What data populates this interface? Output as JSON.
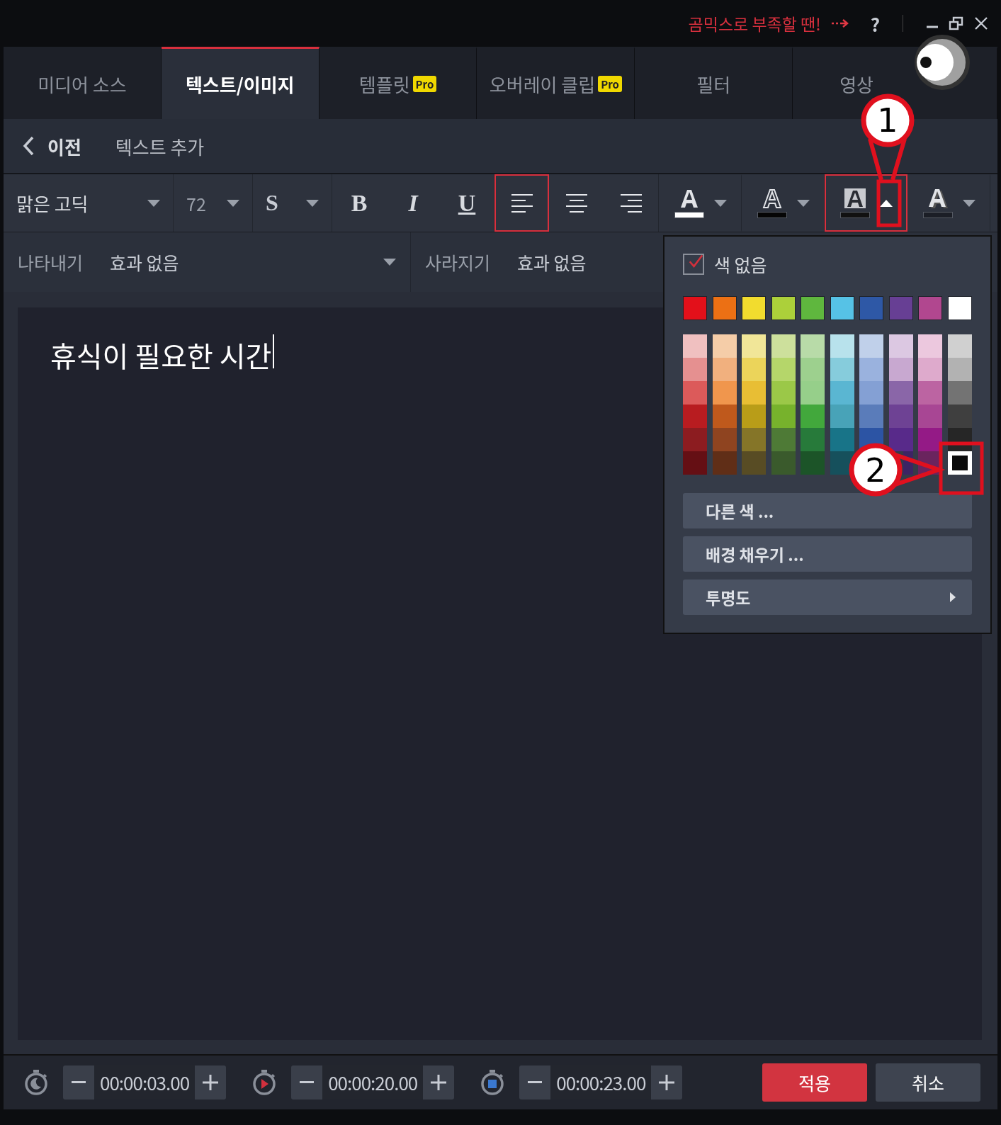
{
  "top_bar": {
    "promo_link": "곰믹스로 부족할 땐!",
    "help": "?"
  },
  "tabs": [
    {
      "label": "미디어 소스",
      "selected": false
    },
    {
      "label": "텍스트/이미지",
      "selected": true
    },
    {
      "label": "템플릿",
      "selected": false,
      "badge": "Pro"
    },
    {
      "label": "오버레이 클립",
      "selected": false,
      "badge": "Pro"
    },
    {
      "label": "필터",
      "selected": false
    },
    {
      "label": "영상",
      "selected": false
    }
  ],
  "nav": {
    "back": "이전",
    "title": "텍스트 추가"
  },
  "toolbar": {
    "font": "맑은 고딕",
    "size": "72",
    "style": "S",
    "format_buttons": [
      {
        "kind": "bold",
        "label": "B"
      },
      {
        "kind": "italic",
        "label": "I"
      },
      {
        "kind": "underline",
        "label": "U"
      }
    ],
    "align_buttons": [
      {
        "kind": "left",
        "selected": true
      },
      {
        "kind": "center",
        "selected": false
      },
      {
        "kind": "right",
        "selected": false
      }
    ],
    "color_buttons": [
      {
        "kind": "text",
        "color": "#ffffff",
        "open": false
      },
      {
        "kind": "outline",
        "color": "#050505",
        "open": false
      },
      {
        "kind": "background",
        "color": "#111111",
        "open": true
      },
      {
        "kind": "shadow",
        "color": "#1b1e26",
        "open": false
      }
    ]
  },
  "effects": [
    {
      "label": "나타내기",
      "value": "효과 없음",
      "dropdown": true
    },
    {
      "label": "사라지기",
      "value": "효과 없음",
      "dropdown": false
    }
  ],
  "editor": {
    "text": "휴식이 필요한 시간"
  },
  "color_popup": {
    "no_color": {
      "label": "색 없음",
      "checked": true
    },
    "base_colors": [
      {
        "color": "#e3101a",
        "selected": false
      },
      {
        "color": "#ec7014",
        "selected": false
      },
      {
        "color": "#f2dc2e",
        "selected": false
      },
      {
        "color": "#acd03a",
        "selected": false
      },
      {
        "color": "#5fb73e",
        "selected": false
      },
      {
        "color": "#56c2e6",
        "selected": false
      },
      {
        "color": "#2e58a6",
        "selected": false
      },
      {
        "color": "#673f94",
        "selected": false
      },
      {
        "color": "#b1478f",
        "selected": false
      },
      {
        "color": "#ffffff",
        "selected": false
      }
    ],
    "shade_columns": [
      [
        {
          "color": "#f0c0c0",
          "selected": false
        },
        {
          "color": "#e59090",
          "selected": false
        },
        {
          "color": "#dc5a5a",
          "selected": false
        },
        {
          "color": "#b81c20",
          "selected": false
        },
        {
          "color": "#8c1c20",
          "selected": false
        },
        {
          "color": "#650f14",
          "selected": false
        }
      ],
      [
        {
          "color": "#f5cda8",
          "selected": false
        },
        {
          "color": "#f1b07e",
          "selected": false
        },
        {
          "color": "#f0964d",
          "selected": false
        },
        {
          "color": "#bf591c",
          "selected": false
        },
        {
          "color": "#8f4420",
          "selected": false
        },
        {
          "color": "#602e17",
          "selected": false
        }
      ],
      [
        {
          "color": "#f1e698",
          "selected": false
        },
        {
          "color": "#ebd45a",
          "selected": false
        },
        {
          "color": "#e8be34",
          "selected": false
        },
        {
          "color": "#b99d18",
          "selected": false
        },
        {
          "color": "#857528",
          "selected": false
        },
        {
          "color": "#584c24",
          "selected": false
        }
      ],
      [
        {
          "color": "#cde09c",
          "selected": false
        },
        {
          "color": "#b5d66a",
          "selected": false
        },
        {
          "color": "#9bc848",
          "selected": false
        },
        {
          "color": "#77b22c",
          "selected": false
        },
        {
          "color": "#4e7a36",
          "selected": false
        },
        {
          "color": "#3a5a2c",
          "selected": false
        }
      ],
      [
        {
          "color": "#b8dba8",
          "selected": false
        },
        {
          "color": "#9dd08e",
          "selected": false
        },
        {
          "color": "#96cf8a",
          "selected": false
        },
        {
          "color": "#42a83c",
          "selected": false
        },
        {
          "color": "#277a3a",
          "selected": false
        },
        {
          "color": "#1c5428",
          "selected": false
        }
      ],
      [
        {
          "color": "#b8e2ec",
          "selected": false
        },
        {
          "color": "#86ccdc",
          "selected": false
        },
        {
          "color": "#5ab6d2",
          "selected": false
        },
        {
          "color": "#48a3b8",
          "selected": false
        },
        {
          "color": "#187488",
          "selected": false
        },
        {
          "color": "#16505c",
          "selected": false
        }
      ],
      [
        {
          "color": "#c0d0ea",
          "selected": false
        },
        {
          "color": "#9ab2de",
          "selected": false
        },
        {
          "color": "#84a0d4",
          "selected": false
        },
        {
          "color": "#5a7cba",
          "selected": false
        },
        {
          "color": "#2c54a4",
          "selected": false
        }
      ],
      [
        {
          "color": "#dcc8e2",
          "selected": false
        },
        {
          "color": "#c8a8d0",
          "selected": false
        },
        {
          "color": "#8a66a8",
          "selected": false
        },
        {
          "color": "#6e4294",
          "selected": false
        },
        {
          "color": "#582a8a",
          "selected": false
        },
        {
          "color": "#3c2464",
          "selected": false
        }
      ],
      [
        {
          "color": "#ecc8de",
          "selected": false
        },
        {
          "color": "#deaacc",
          "selected": false
        },
        {
          "color": "#bc64a2",
          "selected": false
        },
        {
          "color": "#a84694",
          "selected": false
        },
        {
          "color": "#941a86",
          "selected": false
        },
        {
          "color": "#6a245e",
          "selected": false
        }
      ],
      [
        {
          "color": "#d0d0d0",
          "selected": false
        },
        {
          "color": "#b2b2b2",
          "selected": false
        },
        {
          "color": "#737373",
          "selected": false
        },
        {
          "color": "#3f3f3f",
          "selected": false
        },
        {
          "color": "#262626",
          "selected": false
        },
        {
          "color": "#0a0a0a",
          "selected": true
        }
      ]
    ],
    "menu_items": [
      {
        "label": "다른 색 ...",
        "submenu": false
      },
      {
        "label": "배경 채우기 ...",
        "submenu": false
      },
      {
        "label": "투명도",
        "submenu": true
      }
    ]
  },
  "timers": [
    {
      "kind": "start",
      "value": "00:00:03.00"
    },
    {
      "kind": "play",
      "value": "00:00:20.00"
    },
    {
      "kind": "stop",
      "value": "00:00:23.00"
    }
  ],
  "buttons": [
    {
      "kind": "primary",
      "label": "적용"
    },
    {
      "kind": "secondary",
      "label": "취소"
    }
  ],
  "annotations": [
    {
      "label": "1",
      "kind": "caret"
    },
    {
      "label": "2",
      "kind": "swatch"
    }
  ]
}
